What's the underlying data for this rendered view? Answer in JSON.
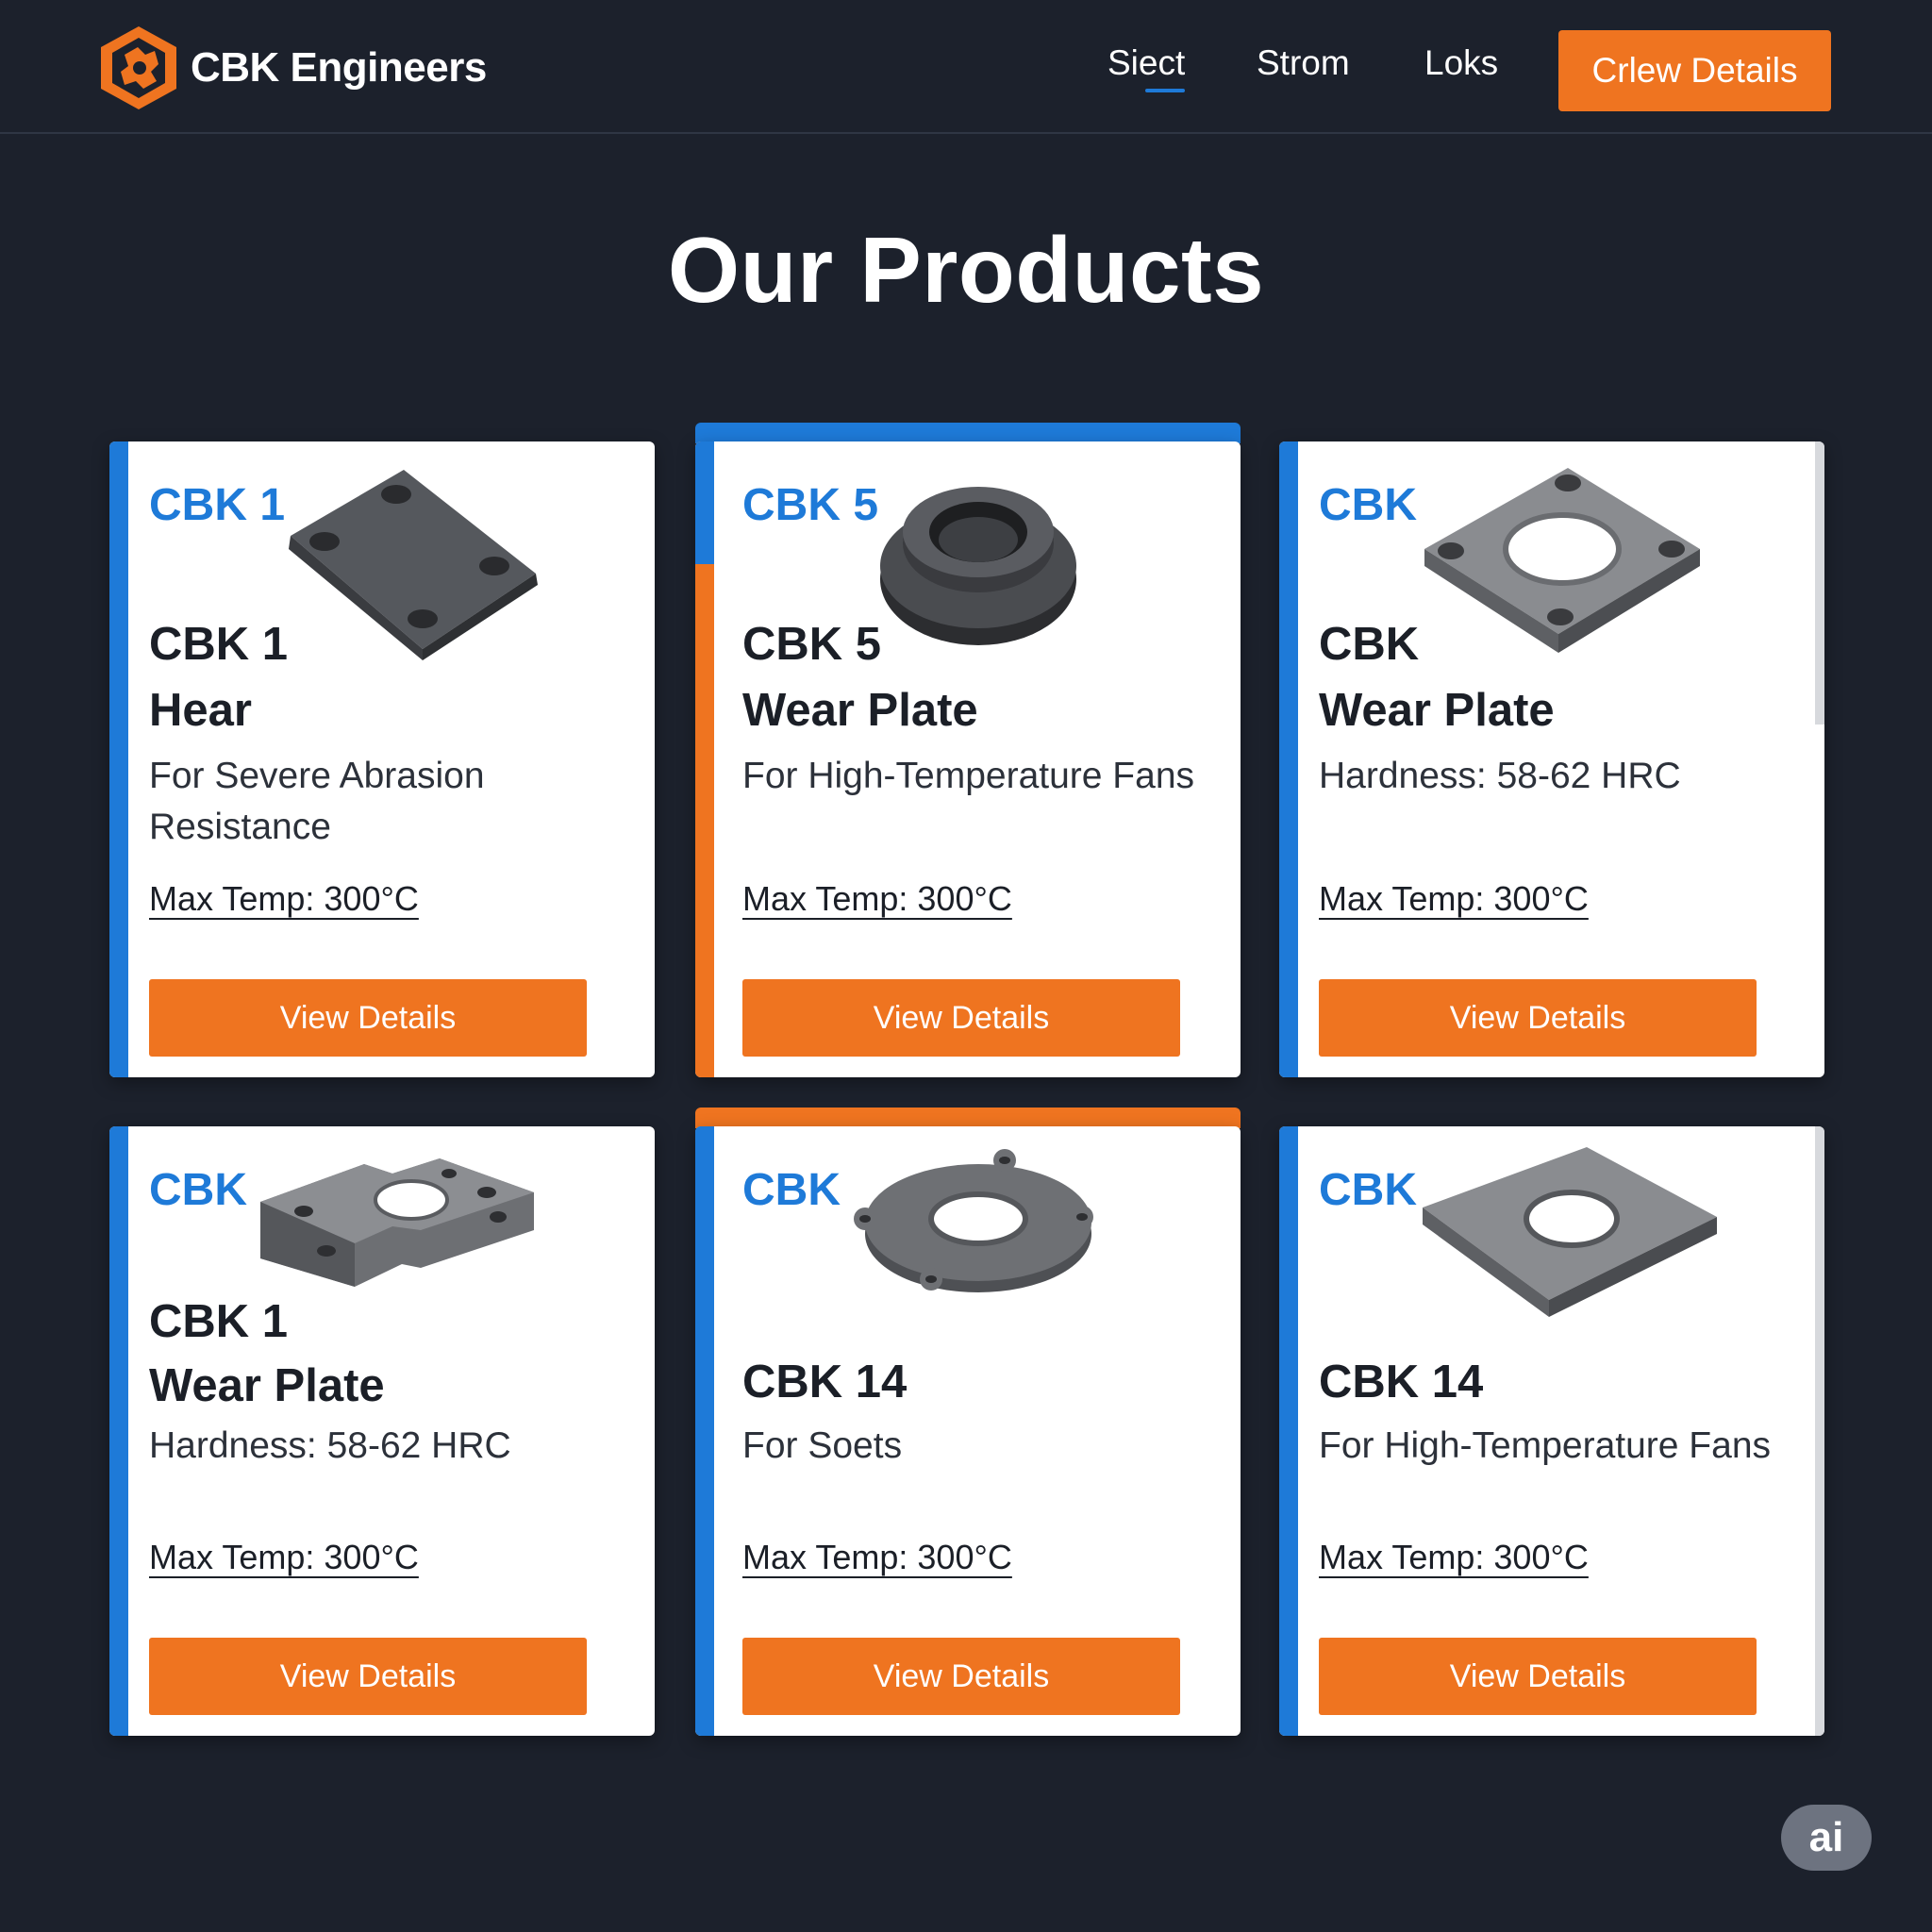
{
  "brand": {
    "name": "CBK Engineers"
  },
  "nav": [
    {
      "label": "Siect"
    },
    {
      "label": "Strom"
    },
    {
      "label": "Loks"
    }
  ],
  "header_cta": "Crlew Details",
  "title": "Our Products",
  "products": [
    {
      "code": "CBK 1",
      "name_line1": "CBK 1",
      "name_line2": "Hear",
      "desc": "For Severe Abrasion Resistance",
      "temp": "Max Temp: 300°C",
      "button": "View Details",
      "image": "square-plate-icon"
    },
    {
      "code": "CBK 5",
      "name_line1": "CBK 5",
      "name_line2": "Wear Plate",
      "desc": "For High-Temperature Fans",
      "temp": "Max Temp: 300°C",
      "button": "View Details",
      "image": "ring-bushing-icon"
    },
    {
      "code": "CBK",
      "name_line1": "CBK",
      "name_line2": "Wear Plate",
      "desc": "Hardness: 58-62 HRC",
      "temp": "Max Temp: 300°C",
      "button": "View Details",
      "image": "flange-plate-icon"
    },
    {
      "code": "CBK",
      "name_line1": "CBK 1",
      "name_line2": "Wear Plate",
      "desc": "Hardness: 58-62 HRC",
      "temp": "Max Temp: 300°C",
      "button": "View Details",
      "image": "notched-plate-icon"
    },
    {
      "code": "CBK",
      "name_line1": "CBK 14",
      "name_line2": "",
      "desc": "For Soets",
      "temp": "Max Temp: 300°C",
      "button": "View Details",
      "image": "round-flange-icon"
    },
    {
      "code": "CBK",
      "name_line1": "CBK 14",
      "name_line2": "",
      "desc": "For High-Temperature Fans",
      "temp": "Max Temp: 300°C",
      "button": "View Details",
      "image": "washer-plate-icon"
    }
  ],
  "ai_badge": "ai",
  "colors": {
    "background": "#1c212c",
    "accent_orange": "#ef7420",
    "accent_blue": "#1e7ad8"
  }
}
